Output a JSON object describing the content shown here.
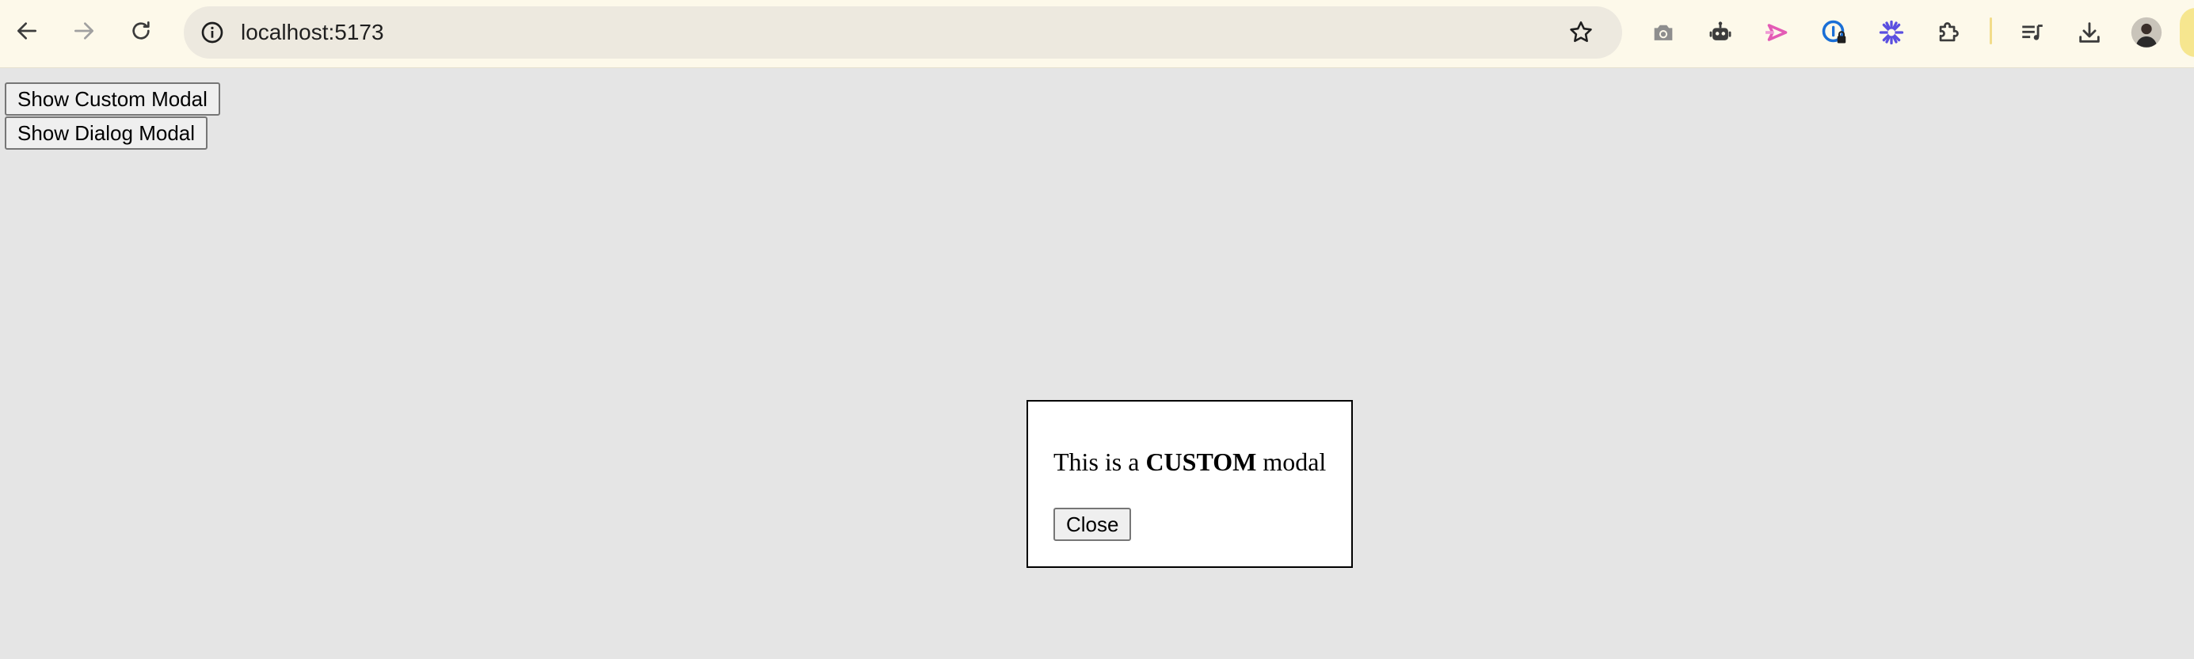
{
  "browser": {
    "url": "localhost:5173",
    "icons": {
      "back": "arrow-left-icon",
      "forward": "arrow-right-icon",
      "reload": "reload-icon",
      "site_info": "info-icon",
      "bookmark": "star-icon",
      "extensions": [
        "camera-icon",
        "robot-icon",
        "pink-arrow-extension-icon",
        "lock-password-icon",
        "asterisk-extension-icon",
        "puzzle-icon"
      ],
      "media": "media-queue-icon",
      "download": "download-icon",
      "profile": "avatar"
    },
    "colors": {
      "toolbar_bg": "#fdf9ea",
      "omnibox_bg": "#ede9df",
      "page_bg": "#e5e5e5"
    }
  },
  "page": {
    "buttons": {
      "custom_modal": "Show Custom Modal",
      "dialog_modal": "Show Dialog Modal"
    },
    "modal": {
      "text_before": "This is a ",
      "text_bold": "CUSTOM",
      "text_after": " modal",
      "close_label": "Close"
    }
  }
}
